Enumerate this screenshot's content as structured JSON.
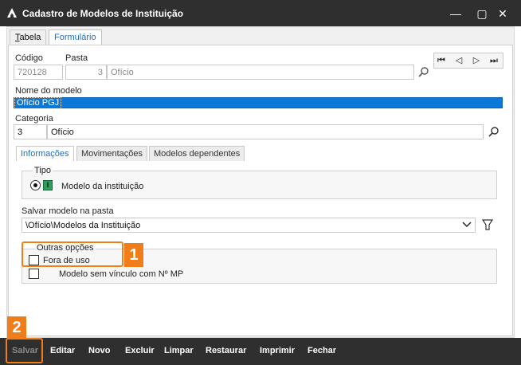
{
  "window": {
    "title": "Cadastro de Modelos de Instituição",
    "minimize": "—",
    "maximize": "▢",
    "close": "✕"
  },
  "tabs": [
    {
      "label": "Tabela",
      "mnemonic": "T",
      "rest": "abela"
    },
    {
      "label": "Formulário",
      "active": true
    }
  ],
  "form": {
    "codigo_label": "Código",
    "codigo_value": "720128",
    "pasta_label": "Pasta",
    "pasta_code": "3",
    "pasta_name": "Ofício",
    "nome_label": "Nome do modelo",
    "nome_value": "Ofício PGJ",
    "categoria_label": "Categoria",
    "categoria_code": "3",
    "categoria_name": "Ofício"
  },
  "nav": {
    "first": "⏮",
    "prev": "◁",
    "next": "▷",
    "last": "⏭"
  },
  "subtabs": [
    {
      "label": "Informações",
      "active": true
    },
    {
      "label": "Movimentações"
    },
    {
      "label": "Modelos dependentes"
    }
  ],
  "tipo": {
    "title": "Tipo",
    "option_label": "Modelo da instituição",
    "option_icon_letter": "I"
  },
  "salvar_pasta": {
    "label": "Salvar modelo na pasta",
    "value": "\\Ofício\\Modelos da Instituição"
  },
  "outras": {
    "title": "Outras opções",
    "fora_de_uso": "Fora de uso",
    "sem_vinculo": "Modelo sem vínculo com Nº MP"
  },
  "badges": {
    "one": "1",
    "two": "2"
  },
  "actions": [
    {
      "label": "Salvar",
      "disabled": true
    },
    {
      "label": "Editar"
    },
    {
      "label": "Novo"
    },
    {
      "label": "Excluir"
    },
    {
      "label": "Limpar"
    },
    {
      "label": "Restaurar"
    },
    {
      "label": "Imprimir"
    },
    {
      "label": "Fechar"
    }
  ],
  "colors": {
    "accent": "#f07c1a",
    "selection": "#0a78d7",
    "titlebar": "#2f2f2f"
  }
}
